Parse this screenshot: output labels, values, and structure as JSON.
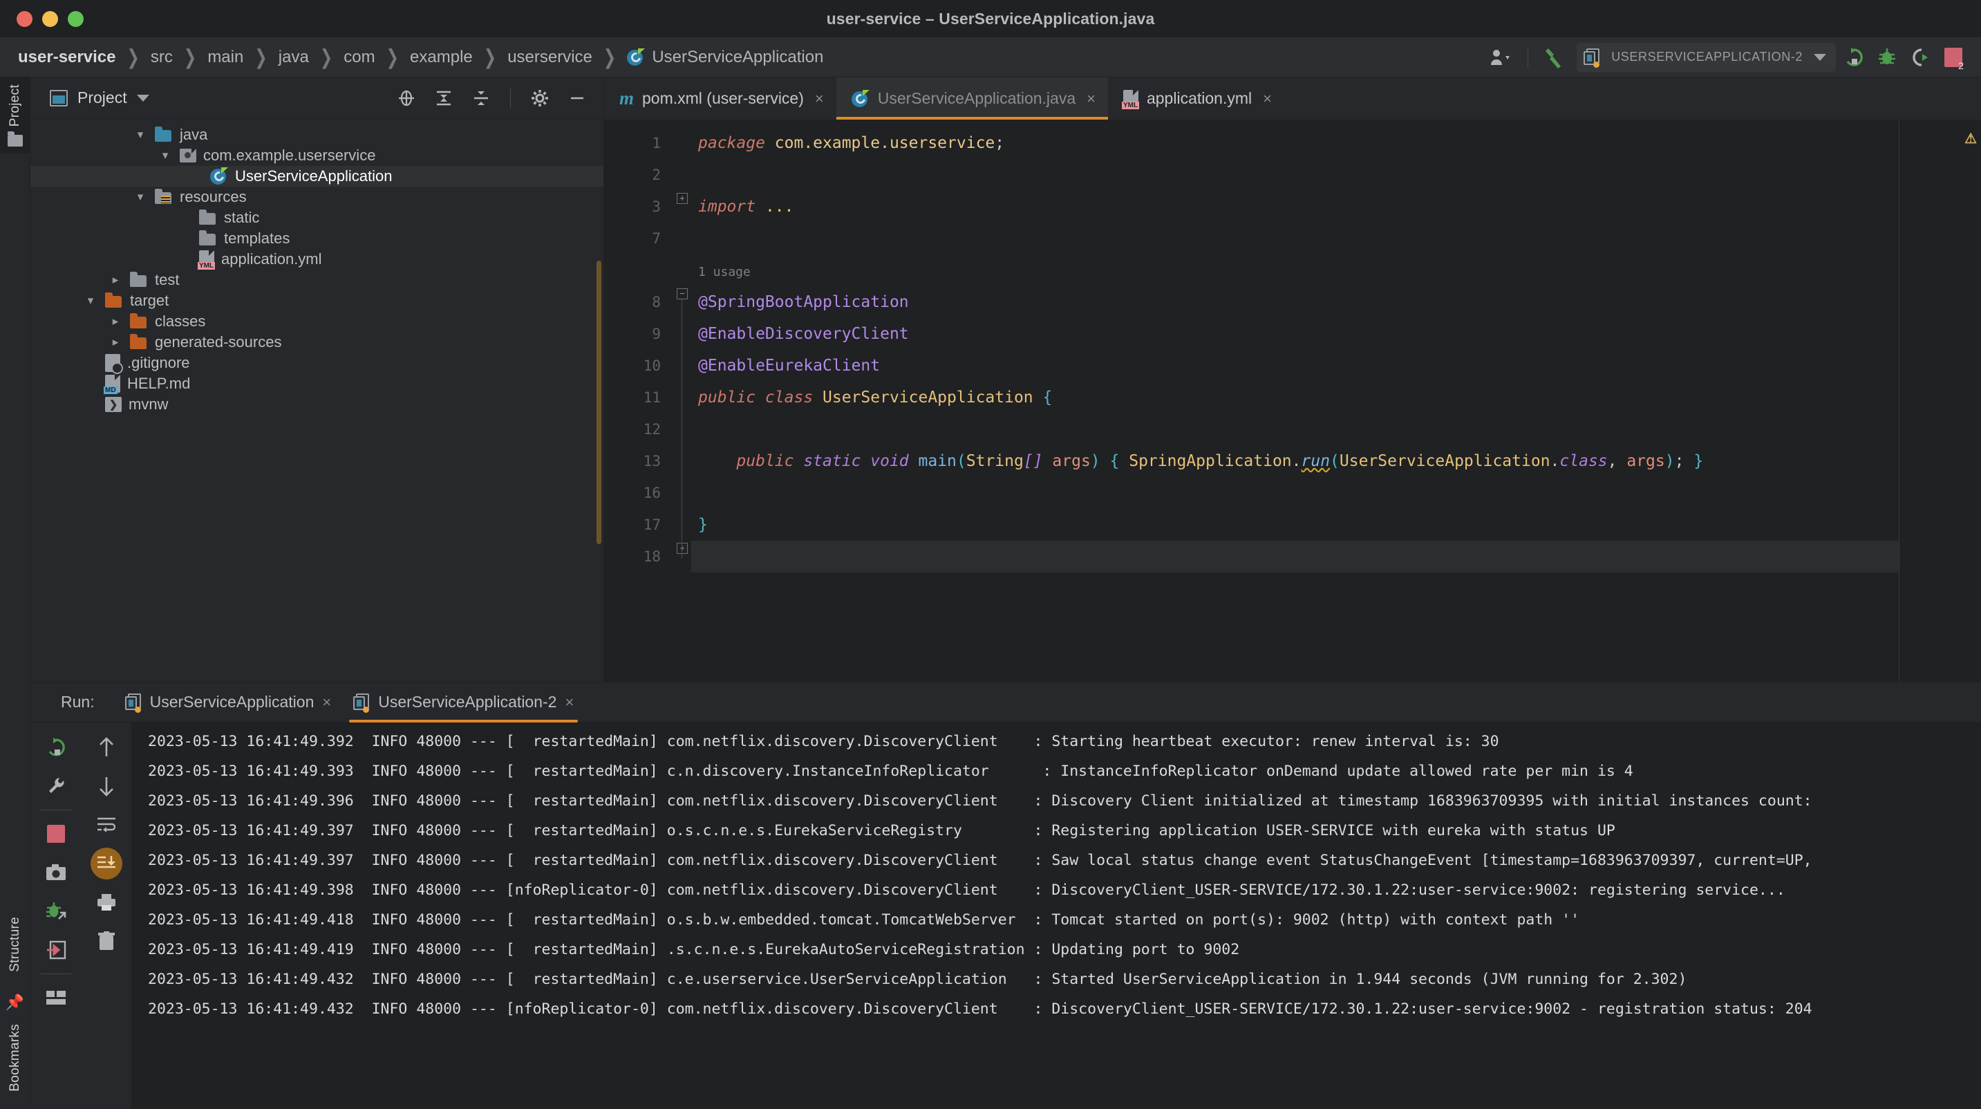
{
  "window": {
    "title": "user-service – UserServiceApplication.java",
    "traffic_colors": {
      "close": "#ec6a5f",
      "minimize": "#f4bf50",
      "zoom": "#61c454"
    }
  },
  "navbar": {
    "breadcrumbs": [
      {
        "label": "user-service",
        "icon": ""
      },
      {
        "label": "src",
        "icon": ""
      },
      {
        "label": "main",
        "icon": ""
      },
      {
        "label": "java",
        "icon": ""
      },
      {
        "label": "com",
        "icon": ""
      },
      {
        "label": "example",
        "icon": ""
      },
      {
        "label": "userservice",
        "icon": ""
      },
      {
        "label": "UserServiceApplication",
        "icon": "spring-boot-class-icon"
      }
    ],
    "separator": "❯",
    "right_icons": [
      "user-account-icon",
      "hammer-build-icon"
    ],
    "run_config": {
      "name": "USERSERVICEAPPLICATION-2",
      "icon": "run-configuration-icon",
      "dropdown": "chevron-down-icon"
    },
    "action_icons": [
      "rerun-icon",
      "debug-icon",
      "coverage-icon",
      "stop-icon"
    ],
    "stop_badge": "2"
  },
  "left_strip": {
    "project_tab": "Project",
    "structure_tab": "Structure",
    "bookmarks_tab": "Bookmarks"
  },
  "project_panel": {
    "title": "Project",
    "dropdown": "chevron-down-icon",
    "toolbar_icons": [
      "select-opened-file-icon",
      "expand-all-icon",
      "collapse-all-icon",
      "settings-gear-icon",
      "hide-panel-icon"
    ],
    "tree": [
      {
        "label": "java",
        "indent": 3,
        "chevron": "down",
        "icon": "folder-source",
        "selected": false
      },
      {
        "label": "com.example.userservice",
        "indent": 4,
        "chevron": "down",
        "icon": "package",
        "selected": false
      },
      {
        "label": "UserServiceApplication",
        "indent": 5,
        "chevron": "none",
        "icon": "spring-boot-class",
        "selected": true
      },
      {
        "label": "resources",
        "indent": 3,
        "chevron": "down",
        "icon": "folder-resources",
        "selected": false
      },
      {
        "label": "static",
        "indent": 4,
        "chevron": "none",
        "icon": "folder",
        "selected": false
      },
      {
        "label": "templates",
        "indent": 4,
        "chevron": "none",
        "icon": "folder",
        "selected": false
      },
      {
        "label": "application.yml",
        "indent": 4,
        "chevron": "none",
        "icon": "file-yml",
        "selected": false
      },
      {
        "label": "test",
        "indent": 2,
        "chevron": "right",
        "icon": "folder",
        "selected": false
      },
      {
        "label": "target",
        "indent": 1,
        "chevron": "down",
        "icon": "folder-excluded",
        "selected": false
      },
      {
        "label": "classes",
        "indent": 2,
        "chevron": "right",
        "icon": "folder-excluded",
        "selected": false
      },
      {
        "label": "generated-sources",
        "indent": 2,
        "chevron": "right",
        "icon": "folder-excluded",
        "selected": false
      },
      {
        "label": ".gitignore",
        "indent": 1,
        "chevron": "none",
        "icon": "file-gitignore",
        "selected": false
      },
      {
        "label": "HELP.md",
        "indent": 1,
        "chevron": "none",
        "icon": "file-md",
        "selected": false
      },
      {
        "label": "mvnw",
        "indent": 1,
        "chevron": "none",
        "icon": "file-shell",
        "selected": false
      }
    ]
  },
  "editor": {
    "tabs": [
      {
        "label": "pom.xml (user-service)",
        "icon": "maven-icon",
        "active": false,
        "close": "×"
      },
      {
        "label": "UserServiceApplication.java",
        "icon": "spring-boot-class-icon",
        "active": true,
        "close": "×"
      },
      {
        "label": "application.yml",
        "icon": "yml-file-icon",
        "active": false,
        "close": "×"
      }
    ],
    "line_numbers": [
      "1",
      "2",
      "3",
      "7",
      "8",
      "9",
      "10",
      "11",
      "12",
      "13",
      "16",
      "17",
      "18"
    ],
    "usage_hint": "1 usage",
    "code_lines": [
      {
        "num": "1",
        "tokens": [
          {
            "t": "package ",
            "c": "kw"
          },
          {
            "t": "com.example.userservice",
            "c": "pkgp"
          },
          {
            "t": ";",
            "c": "punc"
          }
        ]
      },
      {
        "num": "2",
        "tokens": []
      },
      {
        "num": "3",
        "tokens": [
          {
            "t": "import ",
            "c": "kw"
          },
          {
            "t": "...",
            "c": "dots"
          }
        ]
      },
      {
        "num": "7",
        "tokens": []
      },
      {
        "num": "8",
        "tokens": [
          {
            "t": "@SpringBootApplication",
            "c": "ann"
          }
        ]
      },
      {
        "num": "9",
        "tokens": [
          {
            "t": "@EnableDiscoveryClient",
            "c": "ann"
          }
        ]
      },
      {
        "num": "10",
        "tokens": [
          {
            "t": "@EnableEurekaClient",
            "c": "ann"
          }
        ]
      },
      {
        "num": "11",
        "tokens": [
          {
            "t": "public class ",
            "c": "kw"
          },
          {
            "t": "UserServiceApplication",
            "c": "cls"
          },
          {
            "t": " ",
            "c": "punc"
          },
          {
            "t": "{",
            "c": "brace"
          }
        ]
      },
      {
        "num": "12",
        "tokens": []
      },
      {
        "num": "13",
        "tokens": [
          {
            "t": "    ",
            "c": "punc"
          },
          {
            "t": "public ",
            "c": "kw"
          },
          {
            "t": "static void ",
            "c": "kw2"
          },
          {
            "t": "main",
            "c": "meth"
          },
          {
            "t": "(",
            "c": "brace"
          },
          {
            "t": "String",
            "c": "type"
          },
          {
            "t": "[]",
            "c": "kw2"
          },
          {
            "t": " ",
            "c": "punc"
          },
          {
            "t": "args",
            "c": "param"
          },
          {
            "t": ")",
            "c": "brace"
          },
          {
            "t": " ",
            "c": "punc"
          },
          {
            "t": "{",
            "c": "brace"
          },
          {
            "t": " ",
            "c": "punc"
          },
          {
            "t": "SpringApplication",
            "c": "cls"
          },
          {
            "t": ".",
            "c": "punc"
          },
          {
            "t": "run",
            "c": "methu"
          },
          {
            "t": "(",
            "c": "brace"
          },
          {
            "t": "UserServiceApplication",
            "c": "cls"
          },
          {
            "t": ".",
            "c": "punc"
          },
          {
            "t": "class",
            "c": "kw2"
          },
          {
            "t": ", ",
            "c": "punc"
          },
          {
            "t": "args",
            "c": "param"
          },
          {
            "t": ")",
            "c": "brace"
          },
          {
            "t": ";",
            "c": "punc"
          },
          {
            "t": " ",
            "c": "punc"
          },
          {
            "t": "}",
            "c": "brace"
          }
        ]
      },
      {
        "num": "16",
        "tokens": []
      },
      {
        "num": "17",
        "tokens": [
          {
            "t": "}",
            "c": "brace"
          }
        ]
      },
      {
        "num": "18",
        "tokens": []
      }
    ],
    "run_gutter_lines": [
      "11",
      "13"
    ],
    "current_line": "18",
    "inspection_marker": "⚠"
  },
  "run_panel": {
    "label": "Run:",
    "tabs": [
      {
        "label": "UserServiceApplication",
        "active": false,
        "close": "×"
      },
      {
        "label": "UserServiceApplication-2",
        "active": true,
        "close": "×"
      }
    ],
    "toolbar_col1": [
      "rerun-icon",
      "wrench-settings-icon",
      "stop-red-icon",
      "camera-thread-dump-icon",
      "debug-attach-icon",
      "exit-icon",
      "layout-icon"
    ],
    "toolbar_col2": [
      "arrow-up-icon",
      "arrow-down-icon",
      "soft-wrap-icon",
      "scroll-to-end-icon",
      "print-icon",
      "trash-icon"
    ],
    "console_lines": [
      "2023-05-13 16:41:49.392  INFO 48000 --- [  restartedMain] com.netflix.discovery.DiscoveryClient    : Starting heartbeat executor: renew interval is: 30",
      "2023-05-13 16:41:49.393  INFO 48000 --- [  restartedMain] c.n.discovery.InstanceInfoReplicator      : InstanceInfoReplicator onDemand update allowed rate per min is 4",
      "2023-05-13 16:41:49.396  INFO 48000 --- [  restartedMain] com.netflix.discovery.DiscoveryClient    : Discovery Client initialized at timestamp 1683963709395 with initial instances count:",
      "2023-05-13 16:41:49.397  INFO 48000 --- [  restartedMain] o.s.c.n.e.s.EurekaServiceRegistry        : Registering application USER-SERVICE with eureka with status UP",
      "2023-05-13 16:41:49.397  INFO 48000 --- [  restartedMain] com.netflix.discovery.DiscoveryClient    : Saw local status change event StatusChangeEvent [timestamp=1683963709397, current=UP,",
      "2023-05-13 16:41:49.398  INFO 48000 --- [nfoReplicator-0] com.netflix.discovery.DiscoveryClient    : DiscoveryClient_USER-SERVICE/172.30.1.22:user-service:9002: registering service...",
      "2023-05-13 16:41:49.418  INFO 48000 --- [  restartedMain] o.s.b.w.embedded.tomcat.TomcatWebServer  : Tomcat started on port(s): 9002 (http) with context path ''",
      "2023-05-13 16:41:49.419  INFO 48000 --- [  restartedMain] .s.c.n.e.s.EurekaAutoServiceRegistration : Updating port to 9002",
      "2023-05-13 16:41:49.432  INFO 48000 --- [  restartedMain] c.e.userservice.UserServiceApplication   : Started UserServiceApplication in 1.944 seconds (JVM running for 2.302)",
      "2023-05-13 16:41:49.432  INFO 48000 --- [nfoReplicator-0] com.netflix.discovery.DiscoveryClient    : DiscoveryClient_USER-SERVICE/172.30.1.22:user-service:9002 - registration status: 204"
    ]
  },
  "colors": {
    "accent_orange": "#e08a28",
    "selection_marker": "#f0a732",
    "keyword": "#d0786b",
    "annotation": "#b389e9",
    "class_name": "#e7c17a",
    "background": "#1f2123",
    "panel": "#26282b"
  }
}
